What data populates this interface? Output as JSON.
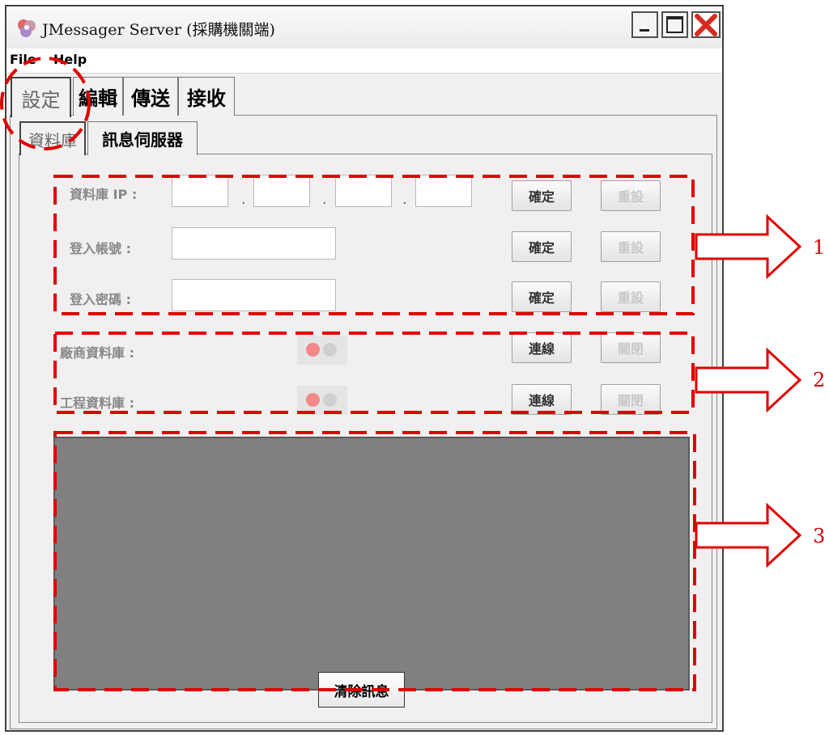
{
  "window": {
    "title": "JMessager Server (採購機關端)",
    "icon": "jmessager-app-icon",
    "controls": [
      "minimize-icon",
      "maximize-icon",
      "close-icon"
    ],
    "colors": {
      "close": "#d92a20"
    }
  },
  "menubar": {
    "items": [
      "File",
      "Help"
    ]
  },
  "tabs": [
    "設定",
    "編輯",
    "傳送",
    "接收"
  ],
  "subtabs": [
    "資料庫",
    "訊息伺服器"
  ],
  "db_form": {
    "rows": [
      {
        "label": "資料庫 IP :",
        "fields": [
          "",
          "",
          "",
          ""
        ],
        "separators": [
          ".",
          ".",
          "."
        ],
        "confirm": "確定",
        "reset": "重設"
      },
      {
        "label": "登入帳號 :",
        "value": "",
        "confirm": "確定",
        "reset": "重設"
      },
      {
        "label": "登入密碼 :",
        "value": "",
        "confirm": "確定",
        "reset": "重設"
      }
    ]
  },
  "connections": {
    "rows": [
      {
        "label": "廠商資料庫 :",
        "status_icon": "status-lamp-icon",
        "connect": "連線",
        "close": "關閉"
      },
      {
        "label": "工程資料庫 :",
        "status_icon": "status-lamp-icon",
        "connect": "連線",
        "close": "關閉"
      }
    ]
  },
  "log": {
    "text": ""
  },
  "clear_button": "清除訊息",
  "callouts": [
    "1",
    "2",
    "3"
  ],
  "annotation_color": "#e00000"
}
